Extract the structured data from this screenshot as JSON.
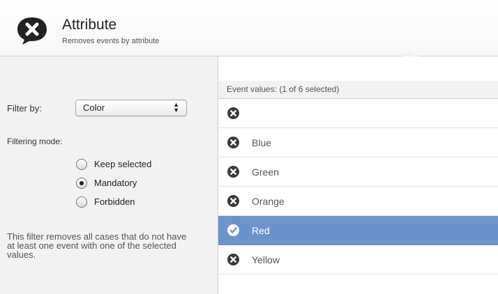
{
  "header": {
    "title": "Attribute",
    "subtitle": "Removes events by attribute",
    "logo_icon": "remove-bubble-icon"
  },
  "filter": {
    "label": "Filter by:",
    "selected": "Color"
  },
  "mode": {
    "label": "Filtering mode:",
    "options": [
      {
        "label": "Keep selected",
        "checked": false
      },
      {
        "label": "Mandatory",
        "checked": true
      },
      {
        "label": "Forbidden",
        "checked": false
      }
    ]
  },
  "description": "This filter removes all cases that do not have at least one event with one of the selected values.",
  "list": {
    "header": "Event values:  (1 of 6 selected)",
    "items": [
      {
        "label": "",
        "selected": false,
        "icon": "x-circle-icon"
      },
      {
        "label": "Blue",
        "selected": false,
        "icon": "x-circle-icon"
      },
      {
        "label": "Green",
        "selected": false,
        "icon": "x-circle-icon"
      },
      {
        "label": "Orange",
        "selected": false,
        "icon": "x-circle-icon"
      },
      {
        "label": "Red",
        "selected": true,
        "icon": "check-circle-icon"
      },
      {
        "label": "Yellow",
        "selected": false,
        "icon": "x-circle-icon"
      }
    ]
  },
  "colors": {
    "selected_row": "#6d93cc",
    "icon_dark": "#3a3a3a"
  }
}
